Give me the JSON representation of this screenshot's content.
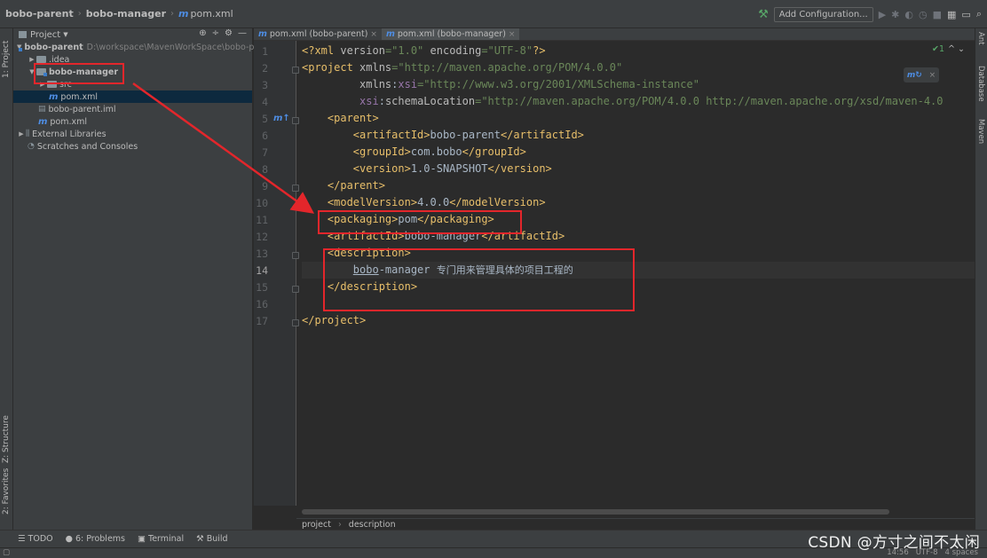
{
  "navbar": {
    "crumbs": [
      "bobo-parent",
      "bobo-manager",
      "pom.xml"
    ],
    "add_config": "Add Configuration..."
  },
  "left_stripe": {
    "project": "1: Project",
    "structure": "Z: Structure",
    "favorites": "2: Favorites"
  },
  "right_stripe": {
    "ant": "Ant",
    "database": "Database",
    "maven": "Maven"
  },
  "project_panel": {
    "title": "Project",
    "tree": [
      {
        "label": "bobo-parent",
        "extra": "D:\\workspace\\MavenWorkSpace\\bobo-parent"
      },
      {
        "label": ".idea"
      },
      {
        "label": "bobo-manager"
      },
      {
        "label": "src"
      },
      {
        "label": "pom.xml"
      },
      {
        "label": "bobo-parent.iml"
      },
      {
        "label": "pom.xml"
      },
      {
        "label": "External Libraries"
      },
      {
        "label": "Scratches and Consoles"
      }
    ]
  },
  "editor": {
    "tabs": [
      {
        "label": "pom.xml (bobo-parent)"
      },
      {
        "label": "pom.xml (bobo-manager)"
      }
    ],
    "inspection": "✔1",
    "line_numbers": [
      "1",
      "2",
      "3",
      "4",
      "5",
      "6",
      "7",
      "8",
      "9",
      "10",
      "11",
      "12",
      "13",
      "14",
      "15",
      "16",
      "17"
    ],
    "breadcrumb": [
      "project",
      "description"
    ]
  },
  "bottom_tools": [
    "TODO",
    "6: Problems",
    "Terminal",
    "Build"
  ],
  "status": {
    "pos": "14:56",
    "encoding": "UTF-8",
    "indent": "4 spaces"
  },
  "watermark": "CSDN @方寸之间不太闲",
  "annotation_color": "#e3262b"
}
